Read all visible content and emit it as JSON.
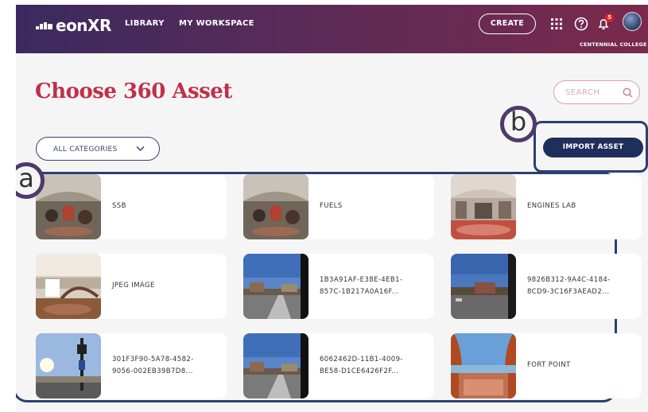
{
  "header": {
    "logo_text": "eonXR",
    "nav_library": "LIBRARY",
    "nav_workspace": "MY WORKSPACE",
    "create_label": "CREATE",
    "notification_count": "5",
    "organization": "CENTENNIAL COLLEGE",
    "icons": [
      "apps-grid-icon",
      "help-icon",
      "bell-icon",
      "avatar"
    ]
  },
  "page": {
    "title": "Choose 360 Asset",
    "search_placeholder": "SEARCH",
    "category_selected": "ALL CATEGORIES",
    "import_label": "IMPORT ASSET"
  },
  "callouts": {
    "a": "a",
    "b": "b"
  },
  "assets": [
    {
      "line1": "SSB",
      "line2": "",
      "thumb": "garage-interior"
    },
    {
      "line1": "FUELS",
      "line2": "",
      "thumb": "garage-interior"
    },
    {
      "line1": "ENGINES LAB",
      "line2": "",
      "thumb": "lab-interior"
    },
    {
      "line1": "JPEG IMAGE",
      "line2": "",
      "thumb": "house-interior"
    },
    {
      "line1": "1B3A91AF-E38E-4EB1-",
      "line2": "857C-1B217A0A16F...",
      "thumb": "street-outdoor"
    },
    {
      "line1": "9826B312-9A4C-4184-",
      "line2": "8CD9-3C16F3AEAD2...",
      "thumb": "parking-outdoor"
    },
    {
      "line1": "301F3F90-5A78-4582-",
      "line2": "9056-002EB39B7D8...",
      "thumb": "sky-sign-outdoor"
    },
    {
      "line1": "6062462D-11B1-4009-",
      "line2": "BE58-D1CE6426F2F...",
      "thumb": "street-outdoor"
    },
    {
      "line1": "FORT POINT",
      "line2": "",
      "thumb": "fort-outdoor"
    }
  ],
  "colors": {
    "title": "#c0304a",
    "header_start": "#3b2a5e",
    "header_end": "#7a2a4c",
    "primary_button": "#1f2f5c",
    "highlight_border": "#2b3f72"
  }
}
